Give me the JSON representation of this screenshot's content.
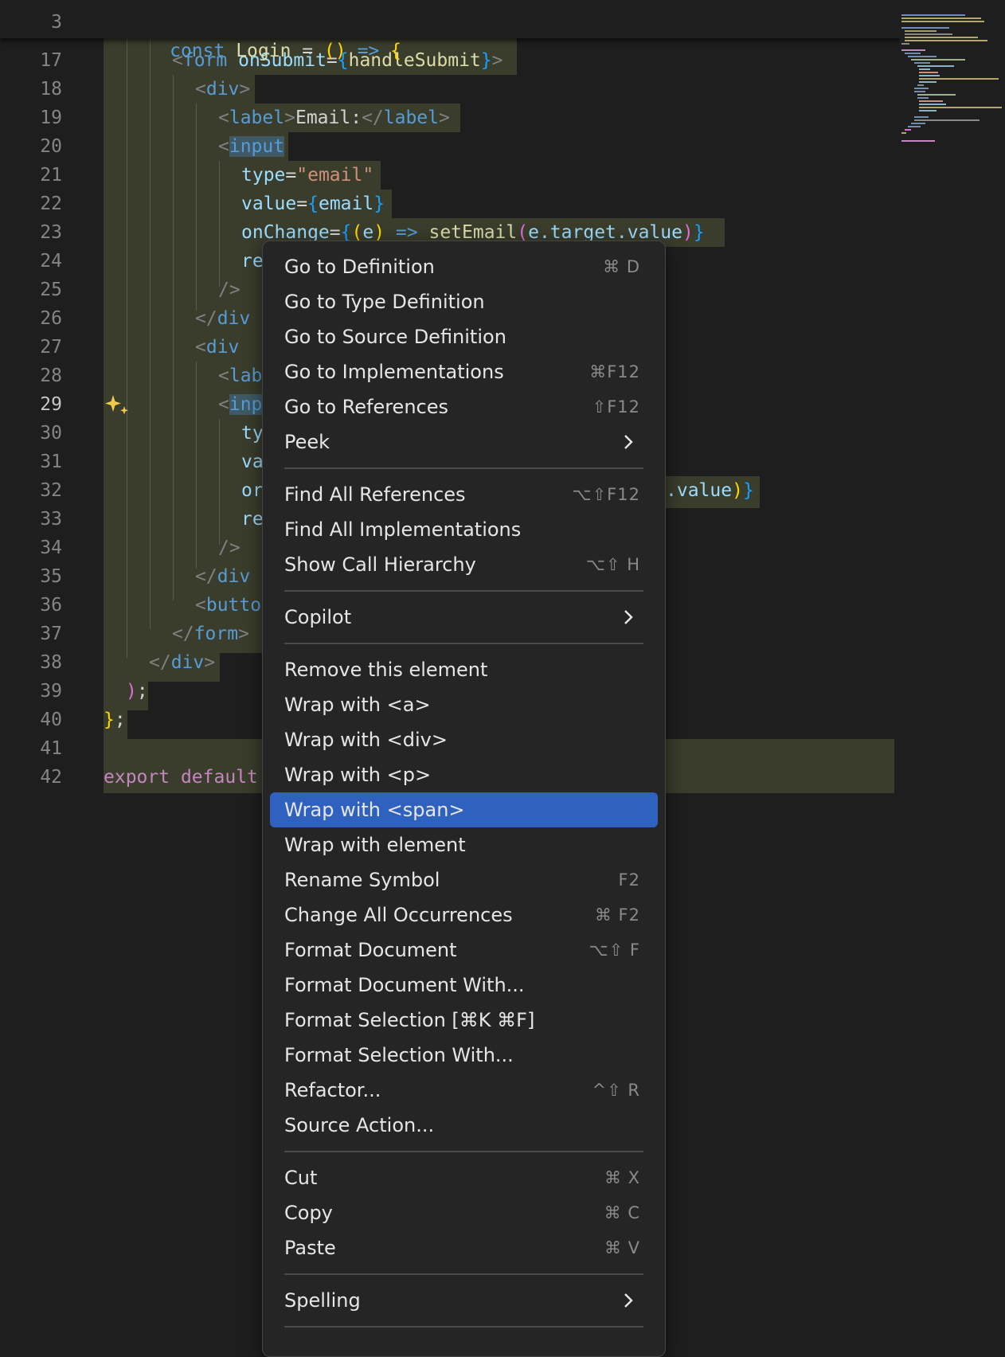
{
  "editor": {
    "sticky": {
      "number": "3",
      "code": "const Login = () => {"
    },
    "lines": [
      {
        "n": "17"
      },
      {
        "n": "18"
      },
      {
        "n": "19"
      },
      {
        "n": "20"
      },
      {
        "n": "21"
      },
      {
        "n": "22"
      },
      {
        "n": "23"
      },
      {
        "n": "24"
      },
      {
        "n": "25"
      },
      {
        "n": "26"
      },
      {
        "n": "27"
      },
      {
        "n": "28"
      },
      {
        "n": "29"
      },
      {
        "n": "30"
      },
      {
        "n": "31"
      },
      {
        "n": "32"
      },
      {
        "n": "33"
      },
      {
        "n": "34"
      },
      {
        "n": "35"
      },
      {
        "n": "36"
      },
      {
        "n": "37"
      },
      {
        "n": "38"
      },
      {
        "n": "39"
      },
      {
        "n": "40"
      },
      {
        "n": "41"
      },
      {
        "n": "42"
      }
    ],
    "active_line": "29",
    "code": {
      "l17": {
        "open": "<",
        "tag": "form",
        "sp": " ",
        "attr": "onSubmit",
        "eq": "=",
        "lb": "{",
        "val": "handleSubmit",
        "rb": "}",
        "close": ">"
      },
      "l18": {
        "open": "<",
        "tag": "div",
        "close": ">"
      },
      "l19": {
        "open": "<",
        "tag": "label",
        "close": ">",
        "text": "Email:",
        "open2": "</",
        "tag2": "label",
        "close2": ">"
      },
      "l20": {
        "open": "<",
        "tag": "input"
      },
      "l21": {
        "attr": "type",
        "eq": "=",
        "str": "\"email\""
      },
      "l22": {
        "attr": "value",
        "eq": "=",
        "lb": "{",
        "val": "email",
        "rb": "}"
      },
      "l23": {
        "attr": "onChange",
        "eq": "=",
        "lb": "{",
        "lp": "(",
        "param": "e",
        "rp": ")",
        "arrow": " => ",
        "fn": "setEmail",
        "lp2": "(",
        "arg": "e.target.value",
        "rp2": ")",
        "rb": "}"
      },
      "l24": {
        "text": "re"
      },
      "l25": {
        "text": "/>"
      },
      "l26": {
        "open": "</",
        "tag": "div"
      },
      "l27": {
        "open": "<",
        "tag": "div"
      },
      "l28": {
        "open": "<",
        "tag": "lab"
      },
      "l29": {
        "open": "<",
        "tag": "inp"
      },
      "l30": {
        "text": "ty"
      },
      "l31": {
        "text": "va"
      },
      "l32": {
        "text": "or",
        "tail": ".value",
        "tail_p": ")",
        "tail_b": "}"
      },
      "l33": {
        "text": "re"
      },
      "l34": {
        "text": "/>"
      },
      "l35": {
        "open": "</",
        "tag": "div"
      },
      "l36": {
        "open": "<",
        "tag": "butto"
      },
      "l37": {
        "open": "</",
        "tag": "form",
        "close": ">"
      },
      "l38": {
        "open": "</",
        "tag": "div",
        "close": ">"
      },
      "l39": {
        "paren": ")",
        "semi": ";"
      },
      "l40": {
        "brace": "}",
        "semi": ";"
      },
      "l42": {
        "kw": "export",
        "kw2": "default"
      }
    }
  },
  "context_menu": {
    "items": [
      {
        "label": "Go to Definition",
        "shortcut": "⌘ D"
      },
      {
        "label": "Go to Type Definition",
        "shortcut": ""
      },
      {
        "label": "Go to Source Definition",
        "shortcut": ""
      },
      {
        "label": "Go to Implementations",
        "shortcut": "⌘F12"
      },
      {
        "label": "Go to References",
        "shortcut": "⇧F12"
      },
      {
        "label": "Peek",
        "shortcut": ""
      },
      {
        "label": "Find All References",
        "shortcut": "⌥⇧F12"
      },
      {
        "label": "Find All Implementations",
        "shortcut": ""
      },
      {
        "label": "Show Call Hierarchy",
        "shortcut": "⌥⇧ H"
      },
      {
        "label": "Copilot",
        "shortcut": ""
      },
      {
        "label": "Remove this element",
        "shortcut": ""
      },
      {
        "label": "Wrap with <a>",
        "shortcut": ""
      },
      {
        "label": "Wrap with <div>",
        "shortcut": ""
      },
      {
        "label": "Wrap with <p>",
        "shortcut": ""
      },
      {
        "label": "Wrap with <span>",
        "shortcut": ""
      },
      {
        "label": "Wrap with element",
        "shortcut": ""
      },
      {
        "label": "Rename Symbol",
        "shortcut": "F2"
      },
      {
        "label": "Change All Occurrences",
        "shortcut": "⌘ F2"
      },
      {
        "label": "Format Document",
        "shortcut": "⌥⇧ F"
      },
      {
        "label": "Format Document With...",
        "shortcut": ""
      },
      {
        "label": "Format Selection [⌘K ⌘F]",
        "shortcut": ""
      },
      {
        "label": "Format Selection With...",
        "shortcut": ""
      },
      {
        "label": "Refactor...",
        "shortcut": "^⇧ R"
      },
      {
        "label": "Source Action...",
        "shortcut": ""
      },
      {
        "label": "Cut",
        "shortcut": "⌘ X"
      },
      {
        "label": "Copy",
        "shortcut": "⌘ C"
      },
      {
        "label": "Paste",
        "shortcut": "⌘ V"
      },
      {
        "label": "Spelling",
        "shortcut": ""
      }
    ],
    "selected": "Wrap with <span>"
  }
}
